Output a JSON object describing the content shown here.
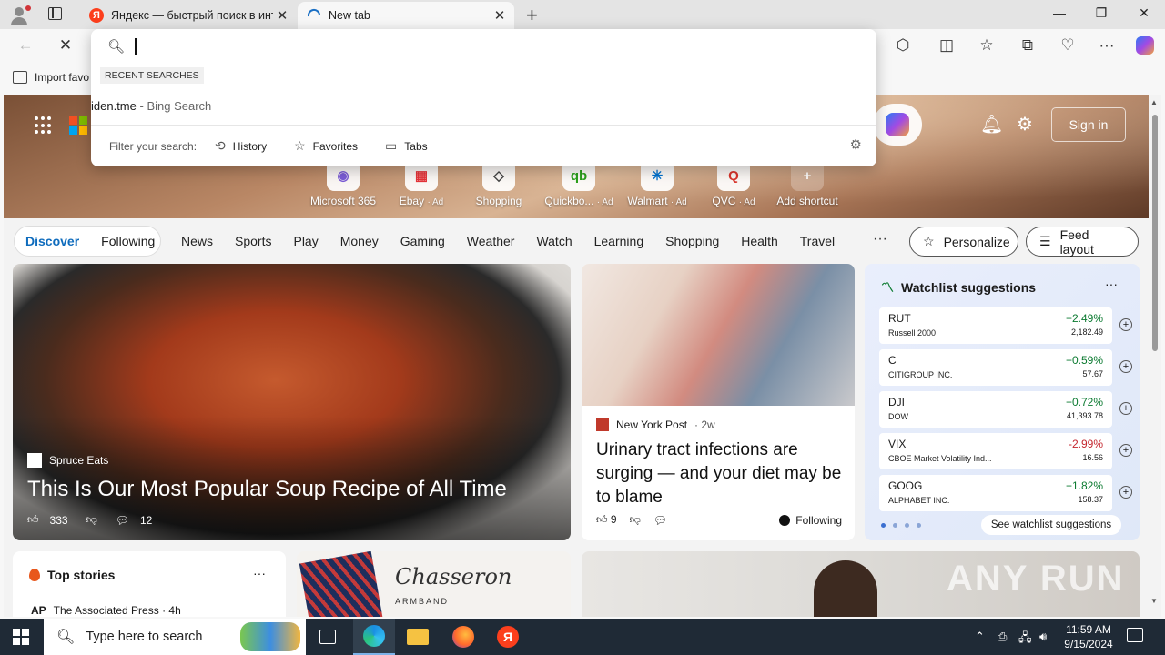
{
  "browser": {
    "tabs": [
      {
        "title": "Яндекс — быстрый поиск в инт",
        "favicon": "yandex-icon",
        "active": false
      },
      {
        "title": "New tab",
        "favicon": "loading-icon",
        "active": true
      }
    ],
    "favicon_yandex_letter": "Я",
    "bookmarks": {
      "import_label": "Import favo"
    }
  },
  "omnibox": {
    "value": "",
    "recent_label": "RECENT SEARCHES",
    "suggestions": [
      {
        "query": "iden.tme",
        "source": "- Bing Search"
      }
    ],
    "filter_label": "Filter your search:",
    "filters": [
      "History",
      "Favorites",
      "Tabs"
    ]
  },
  "hero": {
    "signin_label": "Sign in",
    "shortcuts": [
      {
        "label": "Microsoft 365",
        "ad": ""
      },
      {
        "label": "Ebay",
        "ad": "· Ad"
      },
      {
        "label": "Shopping",
        "ad": ""
      },
      {
        "label": "Quickbo...",
        "ad": "· Ad"
      },
      {
        "label": "Walmart",
        "ad": "· Ad"
      },
      {
        "label": "QVC",
        "ad": "· Ad"
      },
      {
        "label": "Add shortcut",
        "ad": ""
      }
    ]
  },
  "feed_nav": {
    "discover": "Discover",
    "following": "Following",
    "items": [
      "News",
      "Sports",
      "Play",
      "Money",
      "Gaming",
      "Weather",
      "Watch",
      "Learning",
      "Shopping",
      "Health",
      "Travel"
    ],
    "more": "···",
    "personalize": "Personalize",
    "feed_layout": "Feed layout"
  },
  "cards": {
    "main": {
      "source": "Spruce Eats",
      "headline": "This Is Our Most Popular Soup Recipe of All Time",
      "likes": "333",
      "comments": "12"
    },
    "secondary": {
      "source": "New York Post",
      "age": "· 2w",
      "headline": "Urinary tract infections are surging — and your diet may be to blame",
      "likes": "9",
      "following": "Following"
    },
    "watchlist": {
      "title": "Watchlist suggestions",
      "rows": [
        {
          "symbol": "RUT",
          "name": "Russell 2000",
          "change": "+2.49%",
          "price": "2,182.49",
          "dir": "up"
        },
        {
          "symbol": "C",
          "name": "CITIGROUP INC.",
          "change": "+0.59%",
          "price": "57.67",
          "dir": "up"
        },
        {
          "symbol": "DJI",
          "name": "DOW",
          "change": "+0.72%",
          "price": "41,393.78",
          "dir": "up"
        },
        {
          "symbol": "VIX",
          "name": "CBOE Market Volatility Ind...",
          "change": "-2.99%",
          "price": "16.56",
          "dir": "down"
        },
        {
          "symbol": "GOOG",
          "name": "ALPHABET INC.",
          "change": "+1.82%",
          "price": "158.37",
          "dir": "up"
        }
      ],
      "see_all": "See watchlist suggestions"
    },
    "top_stories": {
      "title": "Top stories",
      "source_abbr": "AP",
      "source": "The Associated Press · 4h"
    },
    "promo": {
      "brand": "Chasseron",
      "sub": "ARMBAND"
    }
  },
  "watermark": "ANY RUN",
  "taskbar": {
    "search_placeholder": "Type here to search",
    "time": "11:59 AM",
    "date": "9/15/2024"
  }
}
